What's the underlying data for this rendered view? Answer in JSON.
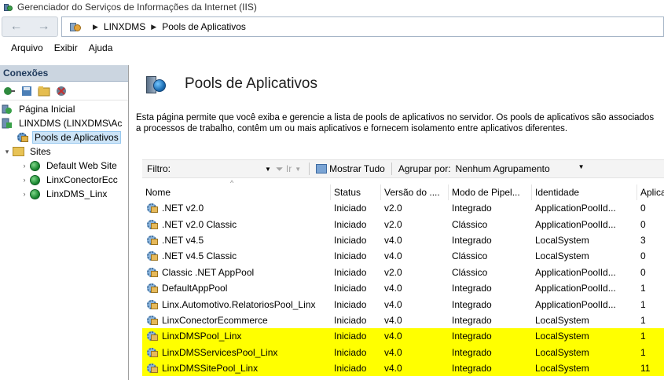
{
  "window": {
    "title": "Gerenciador do Serviços de Informações da Internet (IIS)"
  },
  "address": {
    "crumbs": [
      "LINXDMS",
      "Pools de Aplicativos"
    ]
  },
  "menu": [
    "Arquivo",
    "Exibir",
    "Ajuda"
  ],
  "connections": {
    "header": "Conexões",
    "tree": [
      {
        "label": "Página Inicial",
        "level": 0,
        "icon": "home-server-icon"
      },
      {
        "label": "LINXDMS (LINXDMS\\Ac",
        "level": 0,
        "expander": "",
        "icon": "server-icon"
      },
      {
        "label": "Pools de Aplicativos",
        "level": 1,
        "icon": "app-pool-icon",
        "selected": true
      },
      {
        "label": "Sites",
        "level": 1,
        "expander": "▾",
        "icon": "folder-icon"
      },
      {
        "label": "Default Web Site",
        "level": 2,
        "expander": "›",
        "icon": "globe-icon"
      },
      {
        "label": "LinxConectorEcc",
        "level": 2,
        "expander": "›",
        "icon": "globe-icon"
      },
      {
        "label": "LinxDMS_Linx",
        "level": 2,
        "expander": "›",
        "icon": "globe-icon"
      }
    ]
  },
  "main": {
    "title": "Pools de Aplicativos",
    "description": "Esta página permite que você exiba e gerencie a lista de pools de aplicativos no servidor. Os pools de aplicativos são associados a processos de trabalho, contêm um ou mais aplicativos e fornecem isolamento entre aplicativos diferentes.",
    "filter": {
      "label": "Filtro:",
      "go_label": "Ir",
      "show_all_label": "Mostrar Tudo",
      "group_by_label": "Agrupar por:",
      "group_by_value": "Nenhum Agrupamento"
    },
    "columns": [
      "Nome",
      "Status",
      "Versão do ....",
      "Modo de Pipel...",
      "Identidade",
      "Aplica"
    ],
    "rows": [
      {
        "name": ".NET v2.0",
        "status": "Iniciado",
        "version": "v2.0",
        "mode": "Integrado",
        "identity": "ApplicationPoolId...",
        "apps": "0",
        "highlight": false
      },
      {
        "name": ".NET v2.0 Classic",
        "status": "Iniciado",
        "version": "v2.0",
        "mode": "Clássico",
        "identity": "ApplicationPoolId...",
        "apps": "0",
        "highlight": false
      },
      {
        "name": ".NET v4.5",
        "status": "Iniciado",
        "version": "v4.0",
        "mode": "Integrado",
        "identity": "LocalSystem",
        "apps": "3",
        "highlight": false
      },
      {
        "name": ".NET v4.5 Classic",
        "status": "Iniciado",
        "version": "v4.0",
        "mode": "Clássico",
        "identity": "LocalSystem",
        "apps": "0",
        "highlight": false
      },
      {
        "name": "Classic .NET AppPool",
        "status": "Iniciado",
        "version": "v2.0",
        "mode": "Clássico",
        "identity": "ApplicationPoolId...",
        "apps": "0",
        "highlight": false
      },
      {
        "name": "DefaultAppPool",
        "status": "Iniciado",
        "version": "v4.0",
        "mode": "Integrado",
        "identity": "ApplicationPoolId...",
        "apps": "1",
        "highlight": false
      },
      {
        "name": "Linx.Automotivo.RelatoriosPool_Linx",
        "status": "Iniciado",
        "version": "v4.0",
        "mode": "Integrado",
        "identity": "ApplicationPoolId...",
        "apps": "1",
        "highlight": false
      },
      {
        "name": "LinxConectorEcommerce",
        "status": "Iniciado",
        "version": "v4.0",
        "mode": "Integrado",
        "identity": "LocalSystem",
        "apps": "1",
        "highlight": false
      },
      {
        "name": "LinxDMSPool_Linx",
        "status": "Iniciado",
        "version": "v4.0",
        "mode": "Integrado",
        "identity": "LocalSystem",
        "apps": "1",
        "highlight": true
      },
      {
        "name": "LinxDMSServicesPool_Linx",
        "status": "Iniciado",
        "version": "v4.0",
        "mode": "Integrado",
        "identity": "LocalSystem",
        "apps": "1",
        "highlight": true
      },
      {
        "name": "LinxDMSSitePool_Linx",
        "status": "Iniciado",
        "version": "v4.0",
        "mode": "Integrado",
        "identity": "LocalSystem",
        "apps": "11",
        "highlight": true
      }
    ],
    "highlight_color": "#ffff00"
  }
}
